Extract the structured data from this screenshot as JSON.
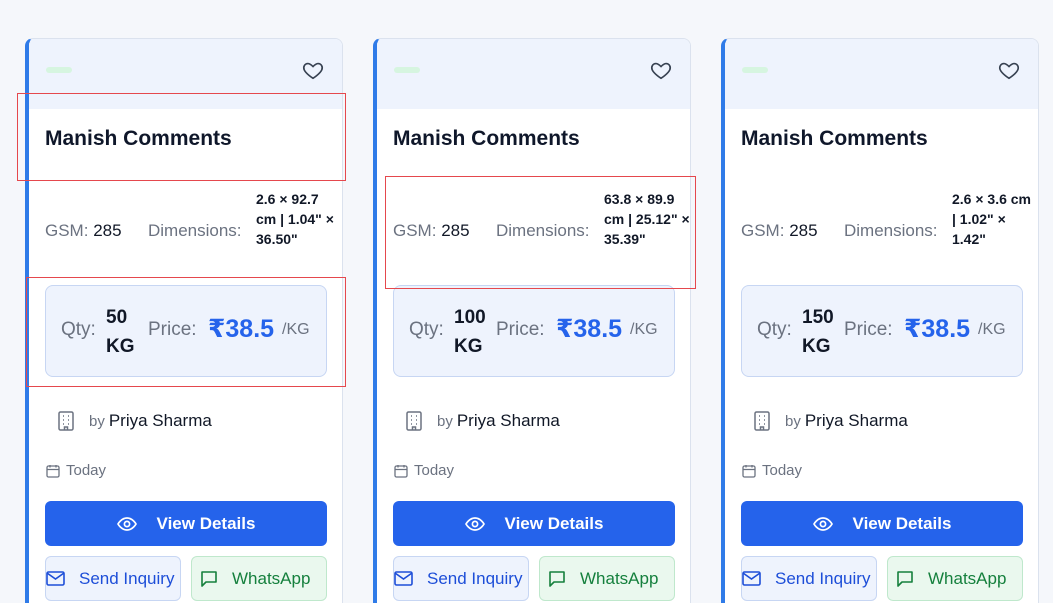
{
  "cards": [
    {
      "title": "Manish Comments",
      "gsm_label": "GSM:",
      "gsm": "285",
      "dim_label": "Dimensions:",
      "dim_value": "2.6 × 92.7 cm | 1.04\" × 36.50\"",
      "qty_label": "Qty:",
      "qty_value": "50 KG",
      "price_label": "Price:",
      "price_value": "₹38.5",
      "price_unit": "/KG",
      "by": "by",
      "seller": "Priya Sharma",
      "date": "Today",
      "view_label": "View Details",
      "inquiry_label": "Send Inquiry",
      "whatsapp_label": "WhatsApp"
    },
    {
      "title": "Manish Comments",
      "gsm_label": "GSM:",
      "gsm": "285",
      "dim_label": "Dimensions:",
      "dim_value": "63.8 × 89.9 cm | 25.12\" × 35.39\"",
      "qty_label": "Qty:",
      "qty_value": "100 KG",
      "price_label": "Price:",
      "price_value": "₹38.5",
      "price_unit": "/KG",
      "by": "by",
      "seller": "Priya Sharma",
      "date": "Today",
      "view_label": "View Details",
      "inquiry_label": "Send Inquiry",
      "whatsapp_label": "WhatsApp"
    },
    {
      "title": "Manish Comments",
      "gsm_label": "GSM:",
      "gsm": "285",
      "dim_label": "Dimensions:",
      "dim_value": "2.6 × 3.6 cm | 1.02\" × 1.42\"",
      "qty_label": "Qty:",
      "qty_value": "150 KG",
      "price_label": "Price:",
      "price_value": "₹38.5",
      "price_unit": "/KG",
      "by": "by",
      "seller": "Priya Sharma",
      "date": "Today",
      "view_label": "View Details",
      "inquiry_label": "Send Inquiry",
      "whatsapp_label": "WhatsApp"
    }
  ],
  "colors": {
    "accent": "#2563eb",
    "card_border_left": "#2f7be8",
    "highlight": "#e5484d",
    "whatsapp": "#15803d"
  },
  "icons": [
    "heart-icon",
    "building-icon",
    "calendar-icon",
    "eye-icon",
    "mail-icon",
    "chat-icon"
  ]
}
